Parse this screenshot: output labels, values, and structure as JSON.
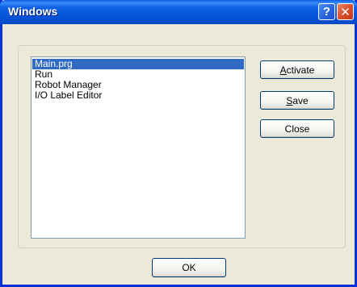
{
  "dialog": {
    "title": "Windows",
    "help_glyph": "?",
    "close_glyph": "✕"
  },
  "windows_list": {
    "items": [
      {
        "label": "Main.prg",
        "selected": true
      },
      {
        "label": "Run",
        "selected": false
      },
      {
        "label": "Robot Manager",
        "selected": false
      },
      {
        "label": "I/O Label Editor",
        "selected": false
      }
    ]
  },
  "buttons": {
    "activate": {
      "mnemonic": "A",
      "rest": "ctivate"
    },
    "save": {
      "mnemonic": "S",
      "rest": "ave"
    },
    "close": "Close",
    "ok": "OK"
  },
  "colors": {
    "titlebar": "#0553d8",
    "selection": "#316ac5",
    "dialog_face": "#ece9d8"
  }
}
